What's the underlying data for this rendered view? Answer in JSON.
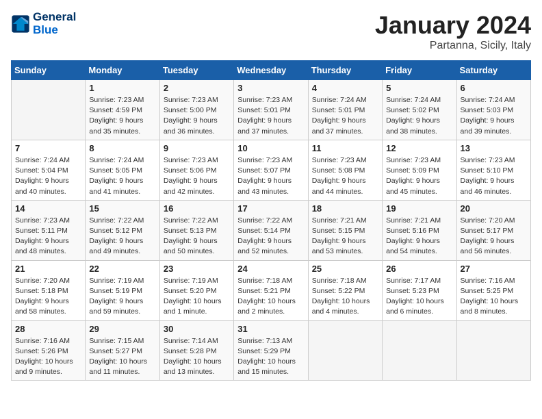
{
  "header": {
    "logo_line1": "General",
    "logo_line2": "Blue",
    "month": "January 2024",
    "location": "Partanna, Sicily, Italy"
  },
  "weekdays": [
    "Sunday",
    "Monday",
    "Tuesday",
    "Wednesday",
    "Thursday",
    "Friday",
    "Saturday"
  ],
  "weeks": [
    [
      {
        "day": "",
        "info": ""
      },
      {
        "day": "1",
        "info": "Sunrise: 7:23 AM\nSunset: 4:59 PM\nDaylight: 9 hours\nand 35 minutes."
      },
      {
        "day": "2",
        "info": "Sunrise: 7:23 AM\nSunset: 5:00 PM\nDaylight: 9 hours\nand 36 minutes."
      },
      {
        "day": "3",
        "info": "Sunrise: 7:23 AM\nSunset: 5:01 PM\nDaylight: 9 hours\nand 37 minutes."
      },
      {
        "day": "4",
        "info": "Sunrise: 7:24 AM\nSunset: 5:01 PM\nDaylight: 9 hours\nand 37 minutes."
      },
      {
        "day": "5",
        "info": "Sunrise: 7:24 AM\nSunset: 5:02 PM\nDaylight: 9 hours\nand 38 minutes."
      },
      {
        "day": "6",
        "info": "Sunrise: 7:24 AM\nSunset: 5:03 PM\nDaylight: 9 hours\nand 39 minutes."
      }
    ],
    [
      {
        "day": "7",
        "info": "Sunrise: 7:24 AM\nSunset: 5:04 PM\nDaylight: 9 hours\nand 40 minutes."
      },
      {
        "day": "8",
        "info": "Sunrise: 7:24 AM\nSunset: 5:05 PM\nDaylight: 9 hours\nand 41 minutes."
      },
      {
        "day": "9",
        "info": "Sunrise: 7:23 AM\nSunset: 5:06 PM\nDaylight: 9 hours\nand 42 minutes."
      },
      {
        "day": "10",
        "info": "Sunrise: 7:23 AM\nSunset: 5:07 PM\nDaylight: 9 hours\nand 43 minutes."
      },
      {
        "day": "11",
        "info": "Sunrise: 7:23 AM\nSunset: 5:08 PM\nDaylight: 9 hours\nand 44 minutes."
      },
      {
        "day": "12",
        "info": "Sunrise: 7:23 AM\nSunset: 5:09 PM\nDaylight: 9 hours\nand 45 minutes."
      },
      {
        "day": "13",
        "info": "Sunrise: 7:23 AM\nSunset: 5:10 PM\nDaylight: 9 hours\nand 46 minutes."
      }
    ],
    [
      {
        "day": "14",
        "info": "Sunrise: 7:23 AM\nSunset: 5:11 PM\nDaylight: 9 hours\nand 48 minutes."
      },
      {
        "day": "15",
        "info": "Sunrise: 7:22 AM\nSunset: 5:12 PM\nDaylight: 9 hours\nand 49 minutes."
      },
      {
        "day": "16",
        "info": "Sunrise: 7:22 AM\nSunset: 5:13 PM\nDaylight: 9 hours\nand 50 minutes."
      },
      {
        "day": "17",
        "info": "Sunrise: 7:22 AM\nSunset: 5:14 PM\nDaylight: 9 hours\nand 52 minutes."
      },
      {
        "day": "18",
        "info": "Sunrise: 7:21 AM\nSunset: 5:15 PM\nDaylight: 9 hours\nand 53 minutes."
      },
      {
        "day": "19",
        "info": "Sunrise: 7:21 AM\nSunset: 5:16 PM\nDaylight: 9 hours\nand 54 minutes."
      },
      {
        "day": "20",
        "info": "Sunrise: 7:20 AM\nSunset: 5:17 PM\nDaylight: 9 hours\nand 56 minutes."
      }
    ],
    [
      {
        "day": "21",
        "info": "Sunrise: 7:20 AM\nSunset: 5:18 PM\nDaylight: 9 hours\nand 58 minutes."
      },
      {
        "day": "22",
        "info": "Sunrise: 7:19 AM\nSunset: 5:19 PM\nDaylight: 9 hours\nand 59 minutes."
      },
      {
        "day": "23",
        "info": "Sunrise: 7:19 AM\nSunset: 5:20 PM\nDaylight: 10 hours\nand 1 minute."
      },
      {
        "day": "24",
        "info": "Sunrise: 7:18 AM\nSunset: 5:21 PM\nDaylight: 10 hours\nand 2 minutes."
      },
      {
        "day": "25",
        "info": "Sunrise: 7:18 AM\nSunset: 5:22 PM\nDaylight: 10 hours\nand 4 minutes."
      },
      {
        "day": "26",
        "info": "Sunrise: 7:17 AM\nSunset: 5:23 PM\nDaylight: 10 hours\nand 6 minutes."
      },
      {
        "day": "27",
        "info": "Sunrise: 7:16 AM\nSunset: 5:25 PM\nDaylight: 10 hours\nand 8 minutes."
      }
    ],
    [
      {
        "day": "28",
        "info": "Sunrise: 7:16 AM\nSunset: 5:26 PM\nDaylight: 10 hours\nand 9 minutes."
      },
      {
        "day": "29",
        "info": "Sunrise: 7:15 AM\nSunset: 5:27 PM\nDaylight: 10 hours\nand 11 minutes."
      },
      {
        "day": "30",
        "info": "Sunrise: 7:14 AM\nSunset: 5:28 PM\nDaylight: 10 hours\nand 13 minutes."
      },
      {
        "day": "31",
        "info": "Sunrise: 7:13 AM\nSunset: 5:29 PM\nDaylight: 10 hours\nand 15 minutes."
      },
      {
        "day": "",
        "info": ""
      },
      {
        "day": "",
        "info": ""
      },
      {
        "day": "",
        "info": ""
      }
    ]
  ]
}
